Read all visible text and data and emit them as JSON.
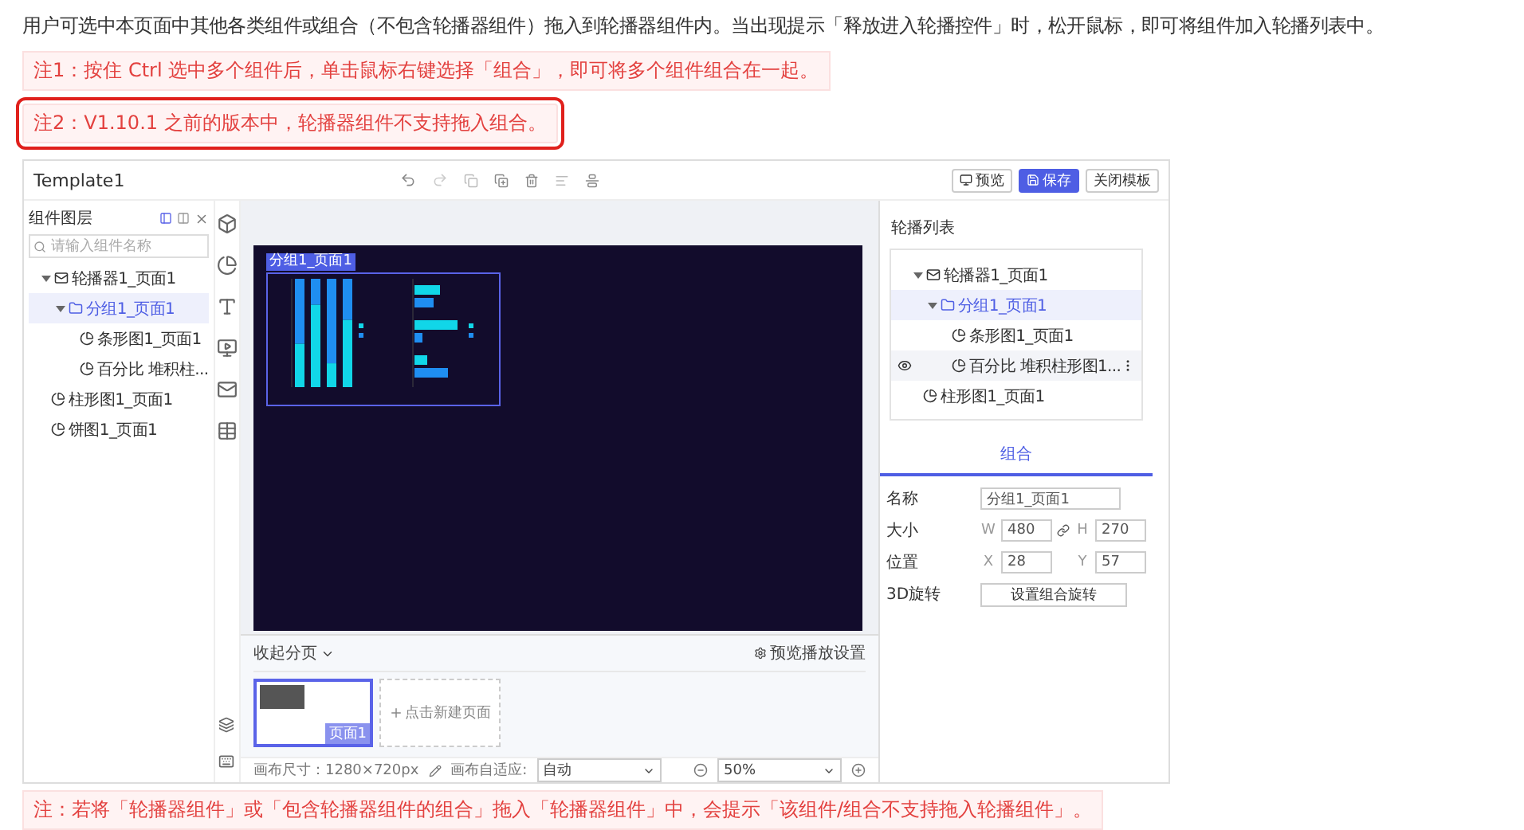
{
  "intro": "用户可选中本页面中其他各类组件或组合（不包含轮播器组件）拖入到轮播器组件内。当出现提示「释放进入轮播控件」时，松开鼠标，即可将组件加入轮播列表中。",
  "notes": [
    {
      "text": "注1：按住 Ctrl 选中多个组件后，单击鼠标右键选择「组合」，即可将多个组件组合在一起。",
      "outlined": false
    },
    {
      "text": "注2：V1.10.1 之前的版本中，轮播器组件不支持拖入组合。",
      "outlined": true
    }
  ],
  "app": {
    "title": "Template1",
    "header_buttons": [
      {
        "label": "预览",
        "kind": "preview",
        "primary": false
      },
      {
        "label": "保存",
        "kind": "save",
        "primary": true
      },
      {
        "label": "关闭模板",
        "kind": "close",
        "primary": false
      }
    ],
    "layers": {
      "title": "组件图层",
      "search": {
        "placeholder": "请输入组件名称"
      },
      "tree": [
        {
          "label": "轮播器1_页面1",
          "kind": "carousel",
          "expanded": true,
          "selected": false,
          "children": [
            {
              "label": "分组1_页面1",
              "kind": "group",
              "expanded": true,
              "selected": true,
              "children": [
                {
                  "label": "条形图1_页面1",
                  "kind": "chart",
                  "selected": false
                },
                {
                  "label": "百分比 堆积柱...",
                  "kind": "chart",
                  "selected": false
                }
              ]
            }
          ]
        },
        {
          "label": "柱形图1_页面1",
          "kind": "chart",
          "selected": false
        },
        {
          "label": "饼图1_页面1",
          "kind": "chart",
          "selected": false
        }
      ]
    },
    "canvas": {
      "selection_label": "分组1_页面1"
    },
    "pages": {
      "collapse": "收起分页",
      "settings": "预览播放设置",
      "add": "点击新建页面",
      "items": [
        {
          "label": "页面1",
          "selected": true
        }
      ]
    },
    "footer": {
      "size": "画布尺寸：1280×720px",
      "fit_label": "画布自适应:",
      "fit_value": "自动",
      "zoom": "50%"
    },
    "carousel_list": {
      "title": "轮播列表",
      "tree": [
        {
          "label": "轮播器1_页面1",
          "kind": "carousel",
          "expanded": true,
          "selected": false,
          "hovered": false,
          "children": [
            {
              "label": "分组1_页面1",
              "kind": "group",
              "expanded": true,
              "selected": true,
              "hovered": false,
              "children": [
                {
                  "label": "条形图1_页面1",
                  "kind": "chart",
                  "selected": false,
                  "hovered": false
                },
                {
                  "label": "百分比 堆积柱形图1...",
                  "kind": "chart",
                  "selected": false,
                  "hovered": true
                }
              ]
            }
          ]
        },
        {
          "label": "柱形图1_页面1",
          "kind": "chart",
          "selected": false,
          "hovered": false
        }
      ]
    },
    "tab": "组合",
    "props": {
      "name_label": "名称",
      "name_value": "分组1_页面1",
      "size_label": "大小",
      "w_label": "W",
      "w_value": "480",
      "h_label": "H",
      "h_value": "270",
      "pos_label": "位置",
      "x_label": "X",
      "x_value": "28",
      "y_label": "Y",
      "y_value": "57",
      "rotate_label": "3D旋转",
      "rotate_button": "设置组合旋转"
    }
  },
  "warning": "注：若将「轮播器组件」或「包含轮播器组件的组合」拖入「轮播器组件」中，会提示「该组件/组合不支持拖入轮播组件」。"
}
